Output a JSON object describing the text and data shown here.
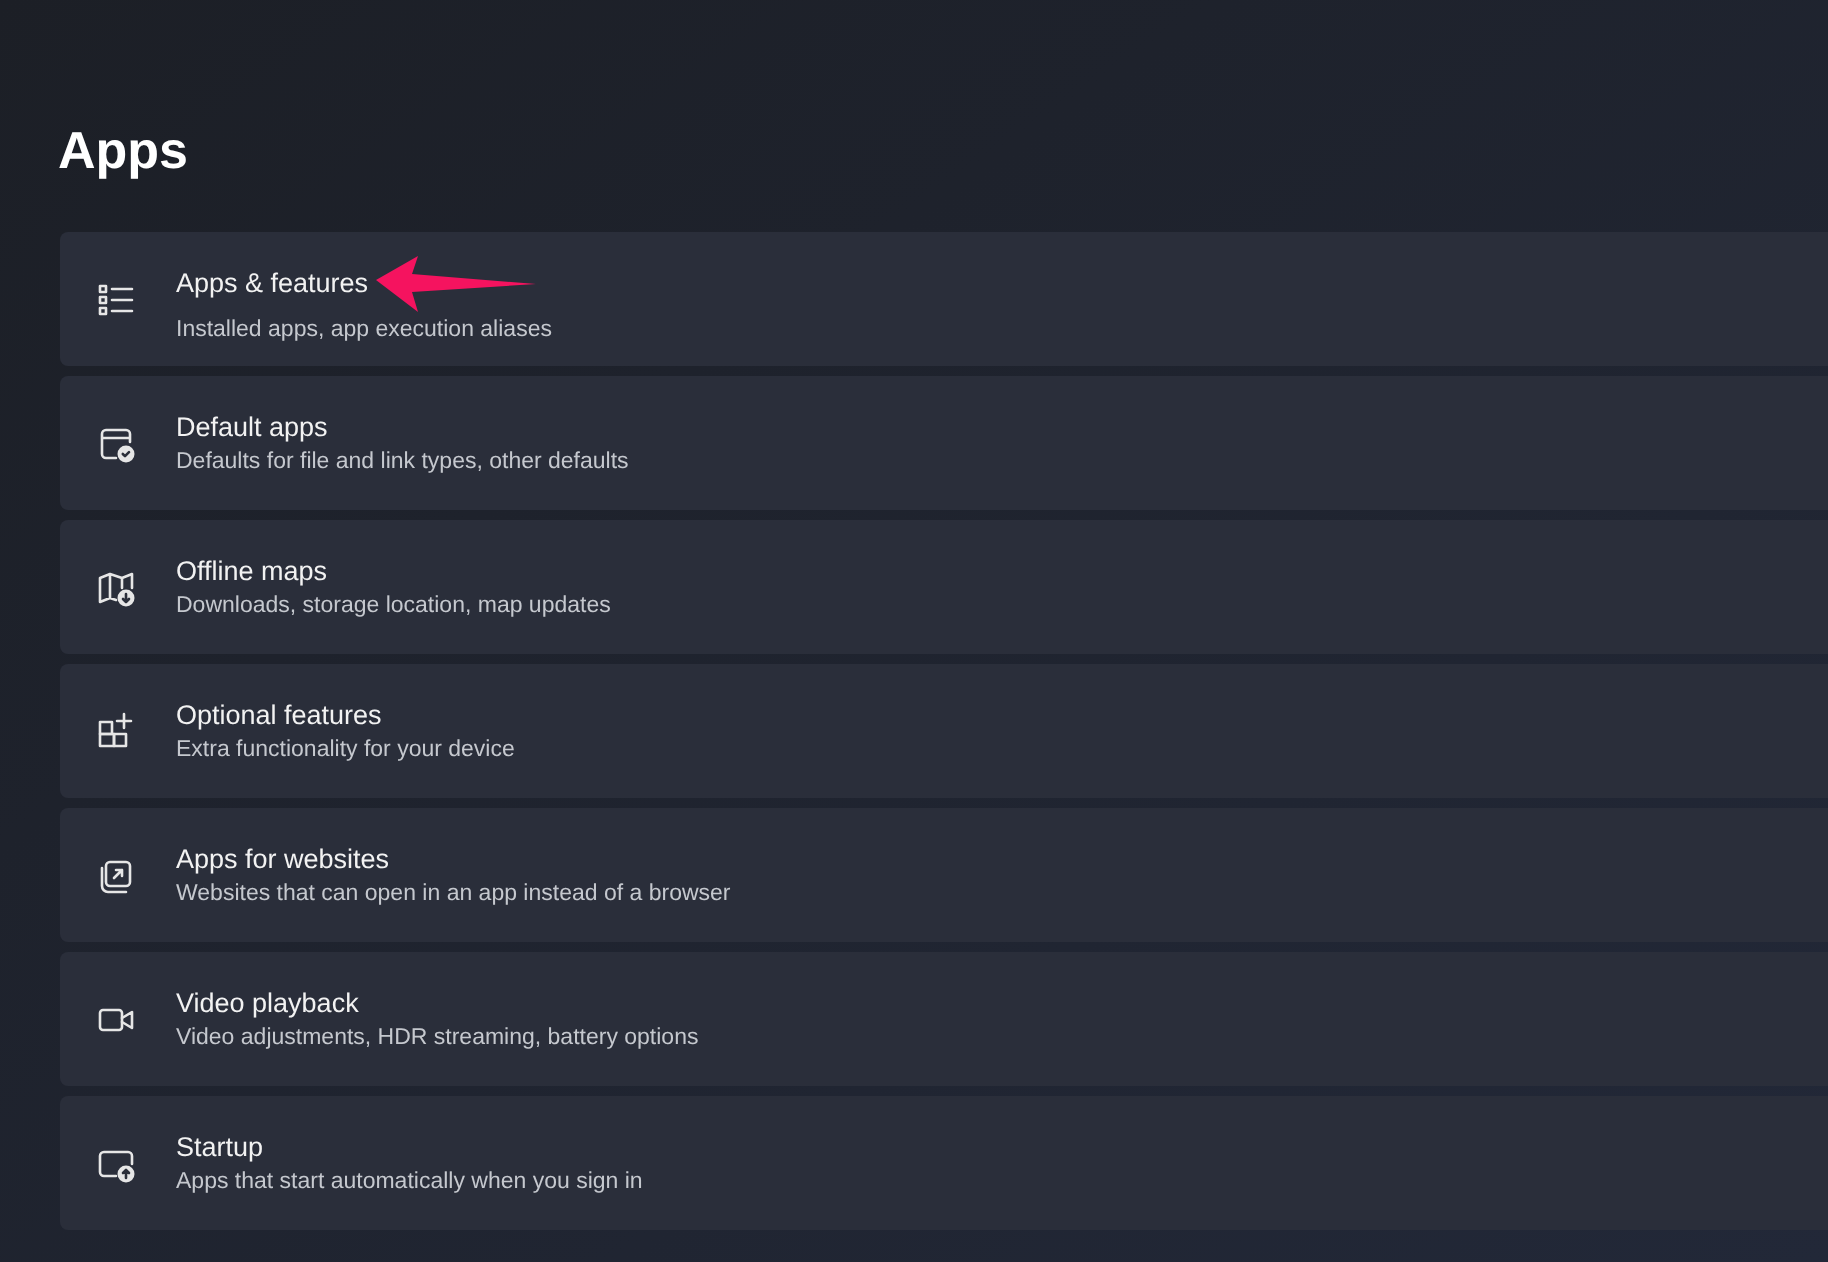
{
  "page": {
    "title": "Apps"
  },
  "items": [
    {
      "title": "Apps & features",
      "subtitle": "Installed apps, app execution aliases",
      "highlighted": true
    },
    {
      "title": "Default apps",
      "subtitle": "Defaults for file and link types, other defaults",
      "highlighted": false
    },
    {
      "title": "Offline maps",
      "subtitle": "Downloads, storage location, map updates",
      "highlighted": false
    },
    {
      "title": "Optional features",
      "subtitle": "Extra functionality for your device",
      "highlighted": false
    },
    {
      "title": "Apps for websites",
      "subtitle": "Websites that can open in an app instead of a browser",
      "highlighted": false
    },
    {
      "title": "Video playback",
      "subtitle": "Video adjustments, HDR streaming, battery options",
      "highlighted": false
    },
    {
      "title": "Startup",
      "subtitle": "Apps that start automatically when you sign in",
      "highlighted": false
    }
  ]
}
